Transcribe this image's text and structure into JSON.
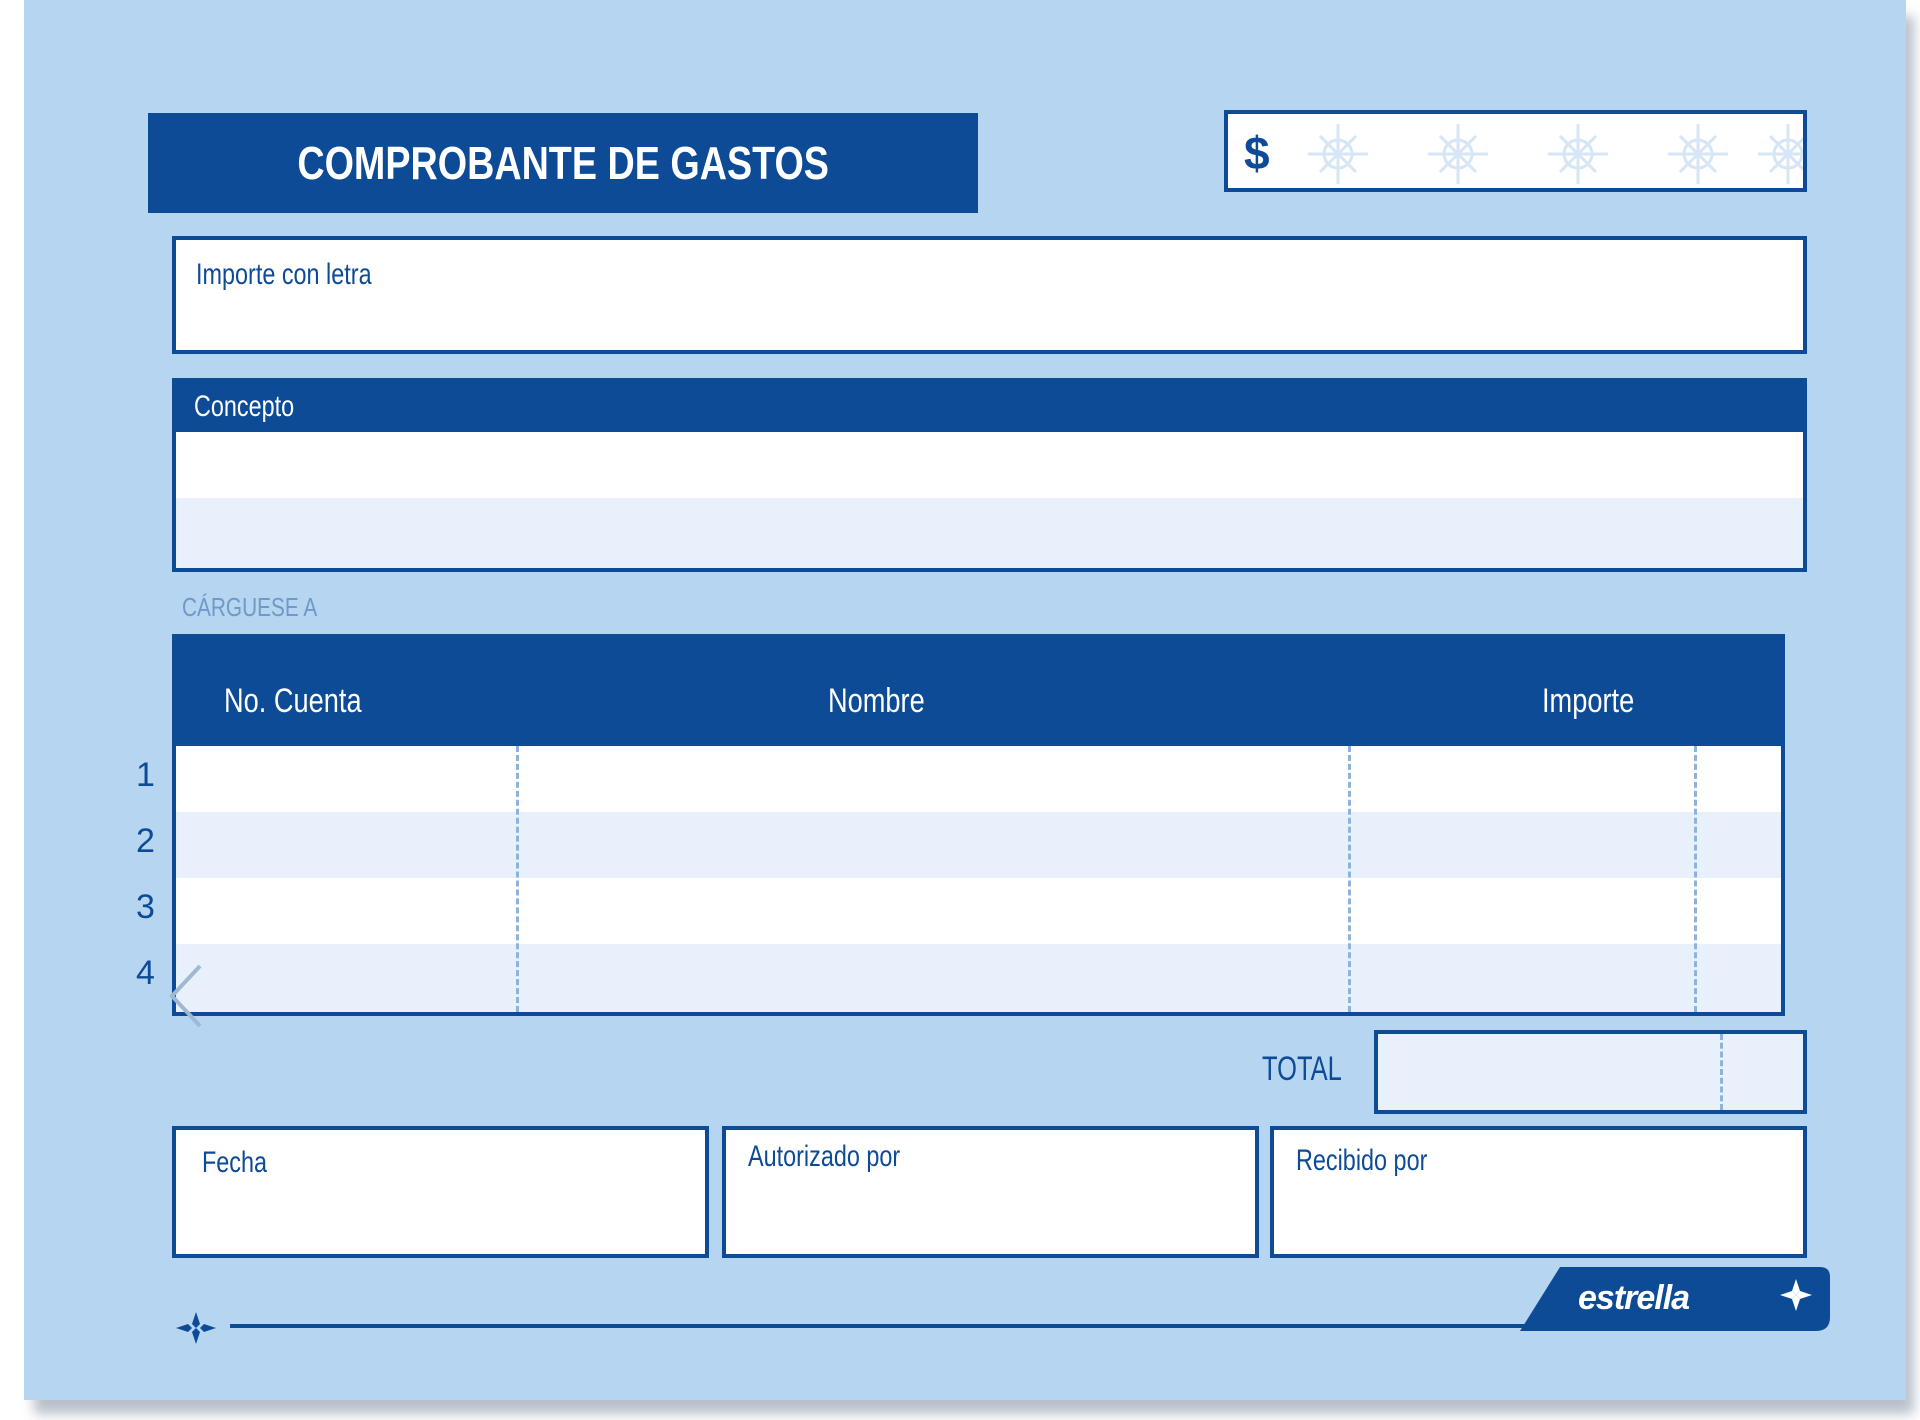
{
  "form": {
    "title": "COMPROBANTE DE GASTOS",
    "currency_symbol": "$",
    "amount_in_words_label": "Importe con letra",
    "concept_label": "Concepto",
    "charge_to_label": "CÁRGUESE A",
    "table": {
      "headers": [
        "No. Cuenta",
        "Nombre",
        "Importe"
      ],
      "row_numbers": [
        "1",
        "2",
        "3",
        "4"
      ]
    },
    "total_label": "TOTAL",
    "signature_fields": [
      "Fecha",
      "Autorizado por",
      "Recibido por"
    ],
    "brand": "estrella"
  },
  "colors": {
    "paper": "#b5d5f0",
    "ink": "#0d4b96",
    "stripe": "#e8f1fb"
  }
}
